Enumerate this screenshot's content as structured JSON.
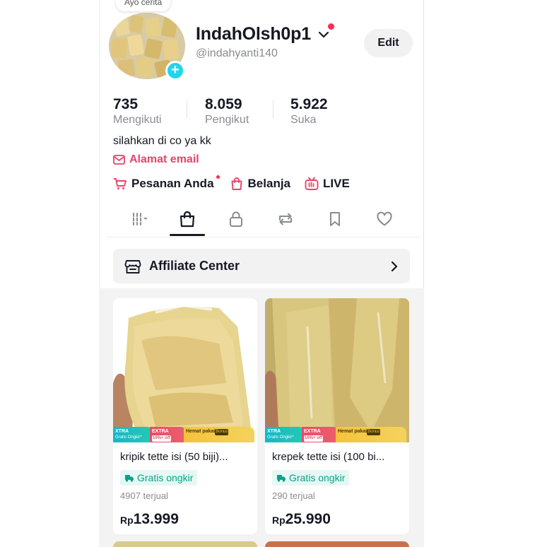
{
  "profile": {
    "note": "Ayo cerita",
    "username": "IndahOlsh0p1",
    "handle": "@indahyanti140",
    "edit_label": "Edit",
    "bio": "silahkan di co ya kk",
    "email_label": "Alamat email"
  },
  "stats": [
    {
      "value": "735",
      "label": "Mengikuti"
    },
    {
      "value": "8.059",
      "label": "Pengikut"
    },
    {
      "value": "5.922",
      "label": "Suka"
    }
  ],
  "shop_links": [
    {
      "label": "Pesanan Anda",
      "icon": "cart-icon"
    },
    {
      "label": "Belanja",
      "icon": "shopping-bag-icon"
    },
    {
      "label": "LIVE",
      "icon": "live-tv-icon"
    }
  ],
  "tabs": [
    {
      "name": "videos-grid-filter",
      "icon": "grid-filter-icon"
    },
    {
      "name": "showcase",
      "icon": "shopping-bag-icon",
      "active": true
    },
    {
      "name": "private",
      "icon": "lock-icon"
    },
    {
      "name": "reposts",
      "icon": "repost-icon"
    },
    {
      "name": "favorites",
      "icon": "bookmark-icon"
    },
    {
      "name": "liked",
      "icon": "heart-icon"
    }
  ],
  "affiliate": {
    "label": "Affiliate Center"
  },
  "products": [
    {
      "title": "kripik tette isi (50 biji)...",
      "badge": "Gratis ongkir",
      "sold": "4907 terjual",
      "currency": "Rp",
      "price": "13.999"
    },
    {
      "title": "krepek tette isi (100 bi...",
      "badge": "Gratis ongkir",
      "sold": "290 terjual",
      "currency": "Rp",
      "price": "25.990"
    }
  ],
  "promo": {
    "xtra_title": "XTRA",
    "xtra_sub": "Gratis Ongkir*",
    "extra_title": "EXTRA",
    "extra_sub": "10%+ off",
    "hemat_title": "Hemat pakai",
    "hemat_sub": "Bonus"
  },
  "colors": {
    "accent_red": "#fe2c55",
    "email_pink": "#e8436b",
    "add_button": "#20d5ec",
    "ongkir_green": "#0aa387"
  }
}
